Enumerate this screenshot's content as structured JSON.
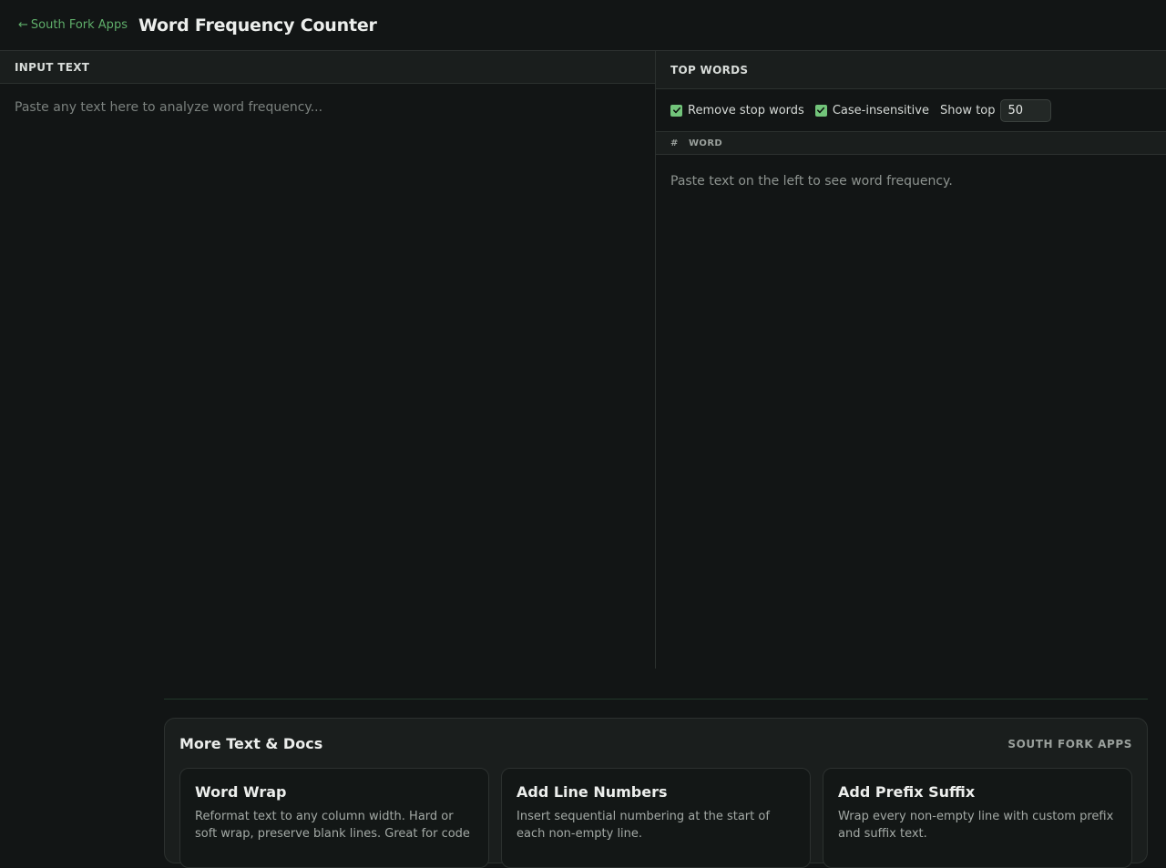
{
  "header": {
    "back_arrow": "←",
    "back_label": "South Fork Apps",
    "title": "Word Frequency Counter"
  },
  "input_panel": {
    "title": "INPUT TEXT",
    "placeholder": "Paste any text here to analyze word frequency..."
  },
  "results_panel": {
    "title": "TOP WORDS",
    "options": {
      "remove_stop_words": {
        "label": "Remove stop words",
        "checked": true
      },
      "case_insensitive": {
        "label": "Case-insensitive",
        "checked": true
      },
      "show_top_label": "Show top",
      "show_top_value": "50"
    },
    "columns": {
      "hash": "#",
      "word": "WORD"
    },
    "empty_message": "Paste text on the left to see word frequency."
  },
  "more": {
    "title": "More Text & Docs",
    "brand": "SOUTH FORK APPS",
    "tools": [
      {
        "name": "Word Wrap",
        "description": "Reformat text to any column width. Hard or soft wrap, preserve blank lines. Great for code"
      },
      {
        "name": "Add Line Numbers",
        "description": "Insert sequential numbering at the start of each non-empty line."
      },
      {
        "name": "Add Prefix Suffix",
        "description": "Wrap every non-empty line with custom prefix and suffix text."
      }
    ]
  },
  "colors": {
    "accent": "#5fae6a",
    "checkbox": "#72c47a",
    "background": "#121515",
    "panel": "#1a1e1d"
  }
}
